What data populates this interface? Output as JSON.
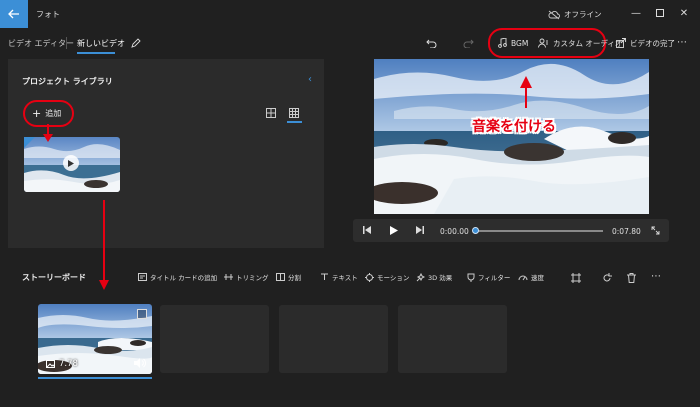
{
  "app": {
    "title": "フォト",
    "offline_label": "オフライン"
  },
  "breadcrumb": {
    "parent": "ビデオ エディター",
    "current": "新しいビデオ"
  },
  "toolbar": {
    "bgm_label": "BGM",
    "custom_audio_label": "カスタム オーディオ",
    "finish_label": "ビデオの完了"
  },
  "library": {
    "title": "プロジェクト ライブラリ",
    "add_label": "追加"
  },
  "annotation": {
    "text": "音楽を付ける",
    "color": "#e60012"
  },
  "player": {
    "current_time": "0:00.00",
    "end_time": "0:07.80",
    "progress": 0.0
  },
  "storyboard": {
    "title": "ストーリーボード",
    "tools": [
      {
        "label": "タイトル カードの追加",
        "icon": "title-card-icon"
      },
      {
        "label": "トリミング",
        "icon": "trim-icon"
      },
      {
        "label": "分割",
        "icon": "split-icon"
      },
      {
        "label": "テキスト",
        "icon": "text-icon"
      },
      {
        "label": "モーション",
        "icon": "motion-icon"
      },
      {
        "label": "3D 効果",
        "icon": "3d-effects-icon"
      },
      {
        "label": "フィルター",
        "icon": "filter-icon"
      },
      {
        "label": "速度",
        "icon": "speed-icon"
      }
    ],
    "clip": {
      "duration": "7.78"
    }
  },
  "colors": {
    "accent": "#3c8fd6",
    "background": "#202020",
    "panel": "#2b2b2b",
    "annotation": "#e60012"
  }
}
